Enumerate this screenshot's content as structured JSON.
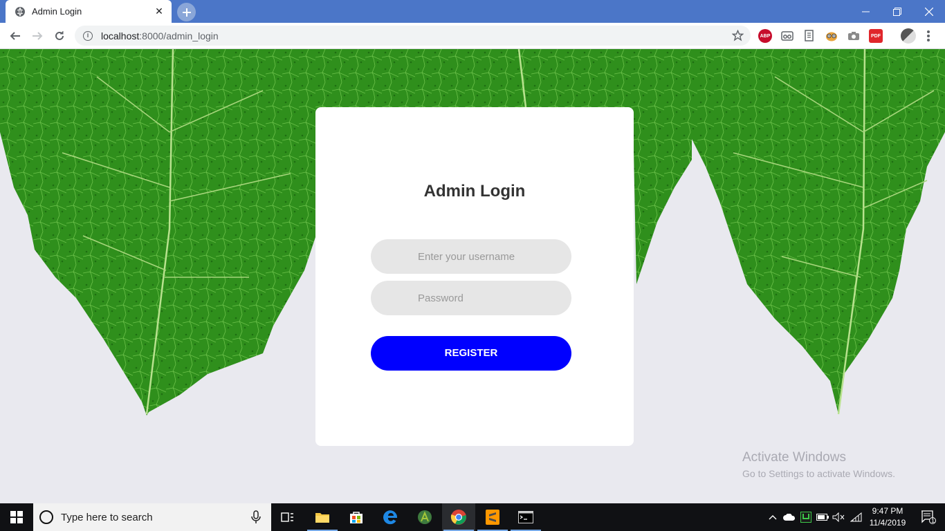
{
  "browser": {
    "tab_title": "Admin Login",
    "url_host": "localhost",
    "url_path": ":8000/admin_login",
    "extensions": [
      {
        "name": "adblock-icon",
        "label": "ABP",
        "color": "#c70d2c"
      },
      {
        "name": "eyeglasses-icon",
        "label": "",
        "color": "#5f6368"
      },
      {
        "name": "document-icon",
        "label": "",
        "color": "#5f6368"
      },
      {
        "name": "owl-icon",
        "label": "",
        "color": "#e8a33c"
      },
      {
        "name": "camera-icon",
        "label": "",
        "color": "#8a8a8a"
      },
      {
        "name": "pdf-icon",
        "label": "PDF",
        "color": "#e0262b"
      }
    ]
  },
  "login": {
    "title": "Admin Login",
    "username_placeholder": "Enter your username",
    "password_placeholder": "Password",
    "submit_label": "REGISTER"
  },
  "watermark": {
    "line1": "Activate Windows",
    "line2": "Go to Settings to activate Windows."
  },
  "taskbar": {
    "search_placeholder": "Type here to search",
    "time": "9:47 PM",
    "date": "11/4/2019",
    "notification_count": "1"
  },
  "colors": {
    "titlebar": "#4b76c8",
    "button": "#0000ff",
    "leaf": "#2e8a1a"
  }
}
